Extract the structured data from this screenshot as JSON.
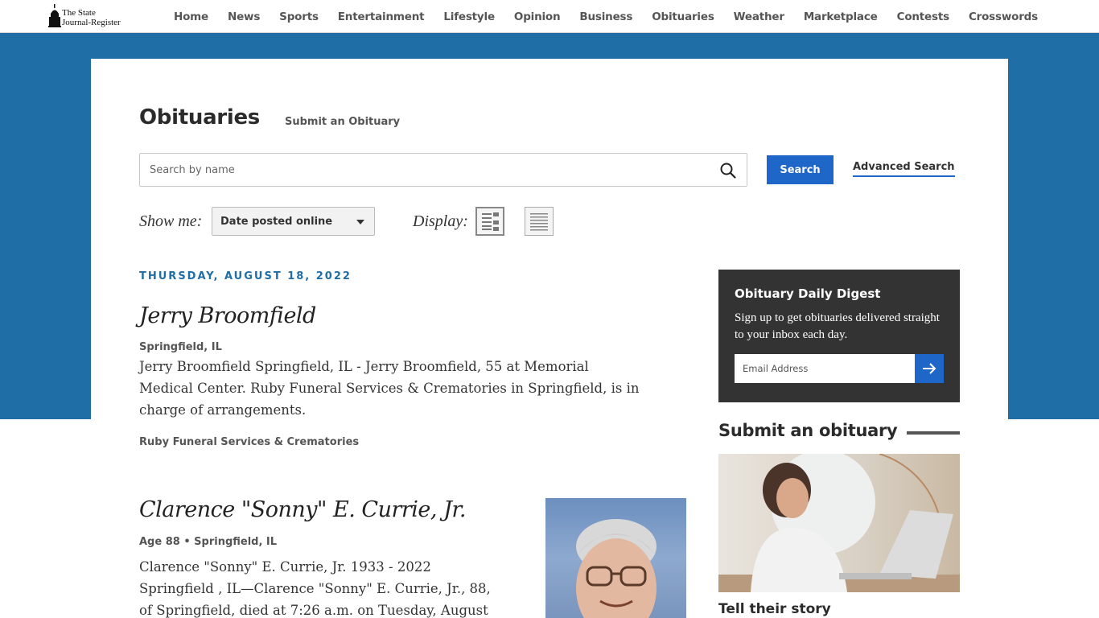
{
  "brand": {
    "line1": "The State",
    "line2": "Journal-Register"
  },
  "nav": [
    "Home",
    "News",
    "Sports",
    "Entertainment",
    "Lifestyle",
    "Opinion",
    "Business",
    "Obituaries",
    "Weather",
    "Marketplace",
    "Contests",
    "Crosswords"
  ],
  "page": {
    "title": "Obituaries",
    "submit_link": "Submit an Obituary"
  },
  "search": {
    "placeholder": "Search by name",
    "button": "Search",
    "advanced": "Advanced Search"
  },
  "filters": {
    "show_me_label": "Show me:",
    "show_me_value": "Date posted online",
    "display_label": "Display:"
  },
  "date_heading": "THURSDAY, AUGUST 18, 2022",
  "obits": [
    {
      "name": "Jerry Broomfield",
      "meta": "Springfield, IL",
      "body": "Jerry Broomfield Springfield, IL - Jerry Broomfield, 55 at Memorial Medical Center. Ruby Funeral Services & Crematories in Springfield, is in charge of arrangements.",
      "funeral_home": "Ruby Funeral Services & Crematories"
    },
    {
      "name": "Clarence \"Sonny\" E. Currie, Jr.",
      "meta": "Age 88 • Springfield, IL",
      "body": "Clarence \"Sonny\" E. Currie, Jr. 1933 - 2022 Springfield , IL—Clarence \"Sonny\" E. Currie, Jr., 88, of Springfield, died at 7:26 a.m. on Tuesday, August"
    }
  ],
  "digest": {
    "title": "Obituary Daily Digest",
    "text": "Sign up to get obituaries delivered straight to your inbox each day.",
    "email_placeholder": "Email Address"
  },
  "submit_promo": {
    "heading": "Submit an obituary",
    "tagline": "Tell their story"
  },
  "colors": {
    "brand_blue": "#1f6ea5",
    "button_blue": "#1e66c8",
    "digest_bg": "#333333"
  }
}
